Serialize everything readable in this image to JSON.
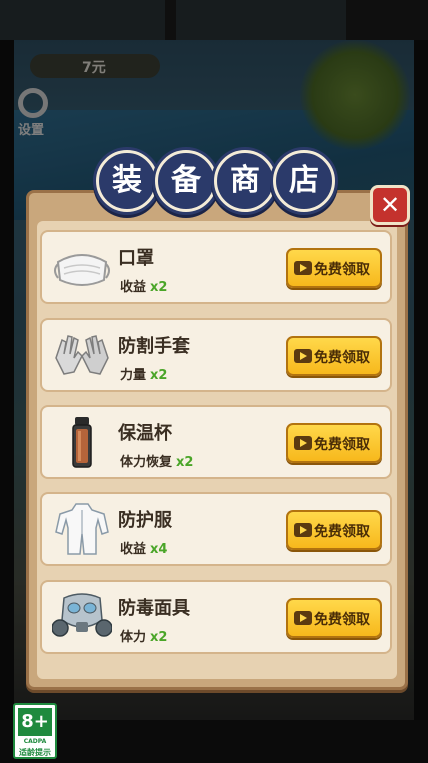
{
  "background": {
    "money_text": "7元",
    "settings_label": "设置"
  },
  "dialog": {
    "title_chars": [
      "装",
      "备",
      "商",
      "店"
    ],
    "close_symbol": "✕"
  },
  "items": [
    {
      "name": "口罩",
      "stat": "收益",
      "multiplier": "x2",
      "button": "免费领取",
      "icon": "mask-icon"
    },
    {
      "name": "防割手套",
      "stat": "力量",
      "multiplier": "x2",
      "button": "免费领取",
      "icon": "gloves-icon"
    },
    {
      "name": "保温杯",
      "stat": "体力恢复",
      "multiplier": "x2",
      "button": "免费领取",
      "icon": "thermos-icon"
    },
    {
      "name": "防护服",
      "stat": "收益",
      "multiplier": "x4",
      "button": "免费领取",
      "icon": "protective-suit-icon"
    },
    {
      "name": "防毒面具",
      "stat": "体力",
      "multiplier": "x2",
      "button": "免费领取",
      "icon": "gas-mask-icon"
    }
  ],
  "age_rating": {
    "age": "8+",
    "org": "CADPA",
    "label": "适龄提示"
  },
  "colors": {
    "title_badge": "#2b3a6a",
    "button_gold": "#f7b81c",
    "multiplier_green": "#4aa528",
    "close_red": "#c4322d"
  }
}
